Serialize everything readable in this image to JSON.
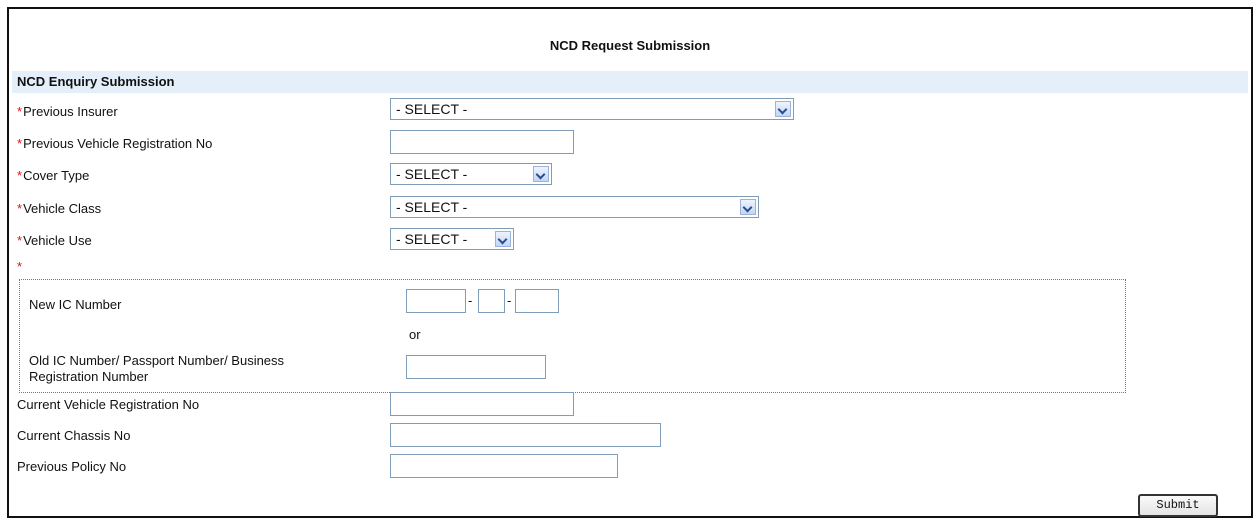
{
  "page": {
    "title": "NCD Request Submission"
  },
  "section": {
    "title": "NCD Enquiry Submission"
  },
  "required_marker": "*",
  "fields": {
    "previous_insurer": {
      "label": "Previous Insurer",
      "value": "- SELECT -"
    },
    "previous_vehicle_reg": {
      "label": "Previous Vehicle Registration No",
      "value": ""
    },
    "cover_type": {
      "label": "Cover Type",
      "value": "- SELECT -"
    },
    "vehicle_class": {
      "label": "Vehicle Class",
      "value": "- SELECT -"
    },
    "vehicle_use": {
      "label": "Vehicle Use",
      "value": "- SELECT -"
    }
  },
  "ic": {
    "new_ic_label": "New IC Number",
    "separator": "-",
    "or_text": "or",
    "old_ic_label_line1": "Old IC Number/ Passport Number/ Business",
    "old_ic_label_line2": "Registration Number"
  },
  "optional_fields": {
    "current_vehicle_reg": {
      "label": "Current Vehicle Registration No",
      "value": ""
    },
    "current_chassis": {
      "label": "Current Chassis No",
      "value": ""
    },
    "previous_policy": {
      "label": "Previous Policy No",
      "value": ""
    }
  },
  "buttons": {
    "submit": "Submit"
  }
}
